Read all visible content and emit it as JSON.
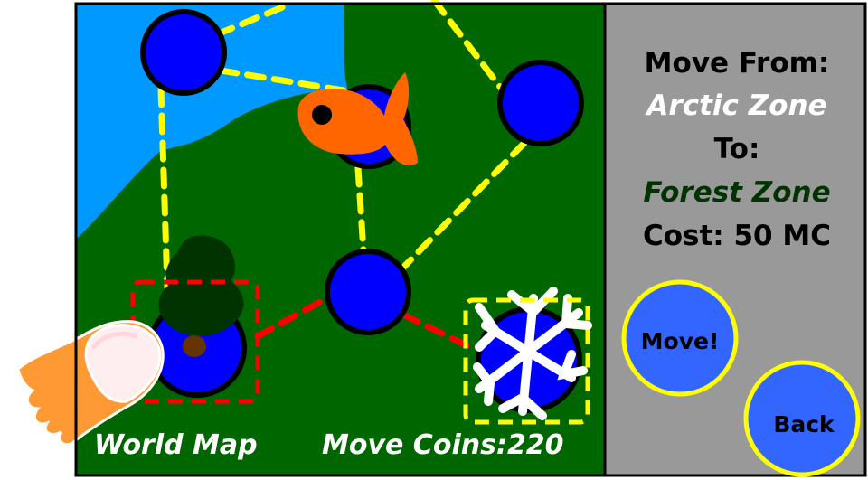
{
  "map": {
    "footer_title": "World Map",
    "coins_label": "Move Coins:",
    "coins_value": "220"
  },
  "panel": {
    "from_label": "Move From:",
    "from_zone": "Arctic Zone",
    "to_label": "To:",
    "to_zone": "Forest Zone",
    "cost_label": "Cost: 50 MC",
    "move_button": "Move!",
    "back_button": "Back"
  },
  "colors": {
    "ocean": "#0099ff",
    "forest": "#006600",
    "panel": "#999999",
    "node": "#0000ff",
    "path": "#ffff00",
    "active_path": "#ff0000",
    "from_zone": "#ffffff",
    "to_zone": "#003300",
    "button_fill": "#3366ff",
    "button_ring": "#ffff00"
  },
  "icons": [
    "fish-icon",
    "pine-tree-icon",
    "snowflake-icon",
    "tap-finger-icon"
  ]
}
